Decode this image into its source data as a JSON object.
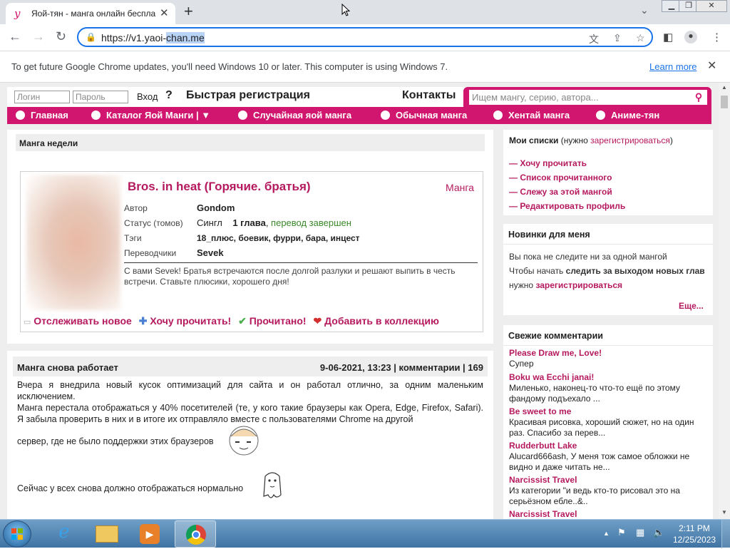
{
  "browser": {
    "tab_title": "Яой-тян - манга онлайн беспла",
    "url_prefix": "https://v1.yaoi-",
    "url_selected": "chan.me",
    "infobar_message": "To get future Google Chrome updates, you'll need Windows 10 or later. This computer is using Windows 7.",
    "infobar_link": "Learn more"
  },
  "header": {
    "login_placeholder": "Логин",
    "password_placeholder": "Пароль",
    "login_button": "Вход",
    "help": "?",
    "quick_register": "Быстрая регистрация",
    "contacts": "Контакты",
    "search_placeholder": "Ищем мангу, серию, автора..."
  },
  "nav": {
    "items": [
      "Главная",
      "Каталог Яой Манги",
      "Случайная яой манга",
      "Обычная манга",
      "Хентай манга",
      "Аниме-тян"
    ]
  },
  "manga_of_week": {
    "section_title": "Манга недели",
    "title": "Bros. in heat (Горячие. братья)",
    "type": "Манга",
    "author_label": "Автор",
    "author": "Gondom",
    "status_label": "Статус (томов)",
    "status_single": "Сингл",
    "status_chapters": "1 глава",
    "status_done": "перевод завершен",
    "tags_label": "Тэги",
    "tags": "18_плюс, боевик, фурри, бара, инцест",
    "translators_label": "Переводчики",
    "translator": "Sevek",
    "description": "С вами Sevek! Братья встречаются после долгой разлуки и решают выпить в честь встречи. Ставьте плюсики, хорошего дня!",
    "actions": [
      "Отслеживать новое",
      "Хочу прочитать!",
      "Прочитано!",
      "Добавить в коллекцию"
    ]
  },
  "news": {
    "title": "Манга снова работает",
    "meta": "9-06-2021, 13:23 | комментарии | 169",
    "p1": "Вчера я внедрила новый кусок оптимизаций для сайта и он работал отлично, за одним маленьким исключением.",
    "p2": "Манга перестала отображаться у 40% посетителей (те, у кого такие браузеры как Opera, Edge, Firefox, Safari). Я забыла проверить в них и в итоге их отправляло вместе с пользователями Chrome на другой",
    "p3": "сервер, где не было поддержки этих браузеров",
    "p4": "Сейчас у всех снова должно отображаться нормально"
  },
  "my_lists": {
    "title": "Мои списки",
    "hint_open": "(нужно ",
    "hint_link": "зарегистрироваться",
    "hint_close": ")",
    "items": [
      "— Хочу прочитать",
      "— Список прочитанного",
      "— Слежу за этой мангой",
      "— Редактировать профиль"
    ]
  },
  "new_for_me": {
    "title": "Новинки для меня",
    "line1": "Вы пока не следите ни за одной мангой",
    "line2a": "Чтобы начать ",
    "line2b": "следить за выходом новых глав",
    "line3a": "нужно ",
    "line3b": "зарегистрироваться",
    "more": "Еще..."
  },
  "comments": {
    "title": "Свежие комментарии",
    "items": [
      {
        "title": "Please Draw me, Love!",
        "text": "Супер"
      },
      {
        "title": "Boku wa Ecchi janai!",
        "text": "Миленько, наконец-то что-то ещё по этому фандому подъехало ..."
      },
      {
        "title": "Be sweet to me",
        "text": "Красивая рисовка, хороший сюжет, но на один раз. Спасибо за перев..."
      },
      {
        "title": "Rudderbutt Lake",
        "text": "Alucard666ash, У меня тож самое обложки не видно и даже читать не..."
      },
      {
        "title": "Narcissist Travel",
        "text": "Из категории \"и ведь кто-то рисовал это на серьёзном ебле..&.."
      },
      {
        "title": "Narcissist Travel",
        "text": ""
      }
    ]
  },
  "taskbar": {
    "time": "2:11 PM",
    "date": "12/25/2023"
  },
  "colors": {
    "brand": "#d0166e",
    "link": "#b5195e",
    "green": "#3a8a2a"
  }
}
